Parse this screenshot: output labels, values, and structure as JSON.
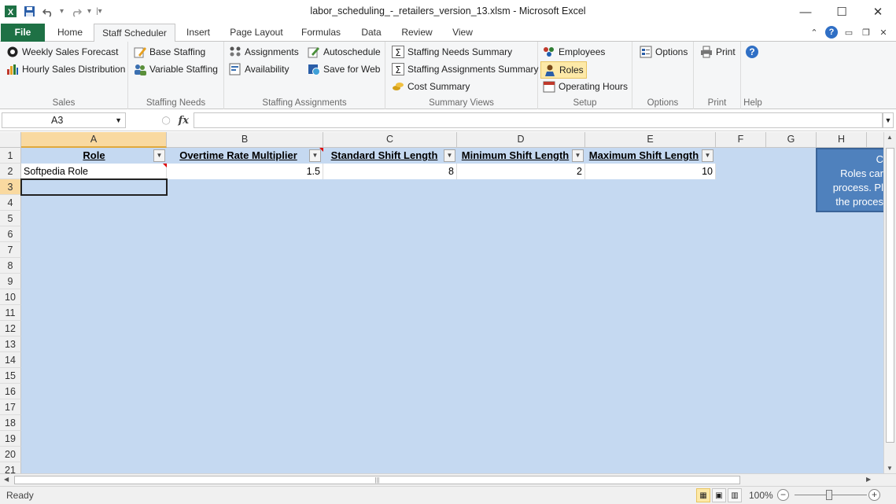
{
  "window": {
    "title": "labor_scheduling_-_retailers_version_13.xlsm  -  Microsoft Excel",
    "minimize": "—",
    "maximize": "☐",
    "close": "✕"
  },
  "tabs": [
    "File",
    "Home",
    "Staff Scheduler",
    "Insert",
    "Page Layout",
    "Formulas",
    "Data",
    "Review",
    "View"
  ],
  "active_tab": "Staff Scheduler",
  "ribbon": {
    "sales": {
      "label": "Sales",
      "weekly": "Weekly Sales Forecast",
      "hourly": "Hourly Sales Distribution"
    },
    "staffing_needs": {
      "label": "Staffing Needs",
      "base": "Base Staffing",
      "variable": "Variable Staffing"
    },
    "staffing_assignments": {
      "label": "Staffing Assignments",
      "assignments": "Assignments",
      "availability": "Availability",
      "autoschedule": "Autoschedule",
      "saveweb": "Save for Web"
    },
    "summary_views": {
      "label": "Summary Views",
      "needs": "Staffing Needs Summary",
      "assign": "Staffing Assignments Summary",
      "cost": "Cost Summary"
    },
    "setup": {
      "label": "Setup",
      "employees": "Employees",
      "roles": "Roles",
      "hours": "Operating Hours"
    },
    "options": {
      "label": "Options",
      "btn": "Options"
    },
    "print": {
      "label": "Print",
      "btn": "Print"
    },
    "help": {
      "label": "Help",
      "btn": "?"
    }
  },
  "formula_bar": {
    "name_box": "A3",
    "fx": "fx",
    "value": ""
  },
  "columns": [
    "A",
    "B",
    "C",
    "D",
    "E",
    "F",
    "G",
    "H"
  ],
  "rows": [
    "1",
    "2",
    "3",
    "4",
    "5",
    "6",
    "7",
    "8",
    "9",
    "10",
    "11",
    "12",
    "13",
    "14",
    "15",
    "16",
    "17",
    "18",
    "19",
    "20",
    "21"
  ],
  "table": {
    "headers": [
      "Role",
      "Overtime Rate Multiplier",
      "Standard Shift Length",
      "Minimum Shift Length",
      "Maximum Shift Length"
    ],
    "row": [
      "Softpedia Role",
      "1.5",
      "8",
      "2",
      "10"
    ]
  },
  "note": {
    "lines": [
      "C",
      "Roles car",
      "process. Pl",
      "the proces"
    ]
  },
  "status": {
    "ready": "Ready",
    "zoom": "100%"
  },
  "colors": {
    "file_tab": "#1e7145",
    "sheet_bg": "#c5d9f1",
    "note_bg": "#4f81bd",
    "selected_header": "#f9d9a0"
  }
}
